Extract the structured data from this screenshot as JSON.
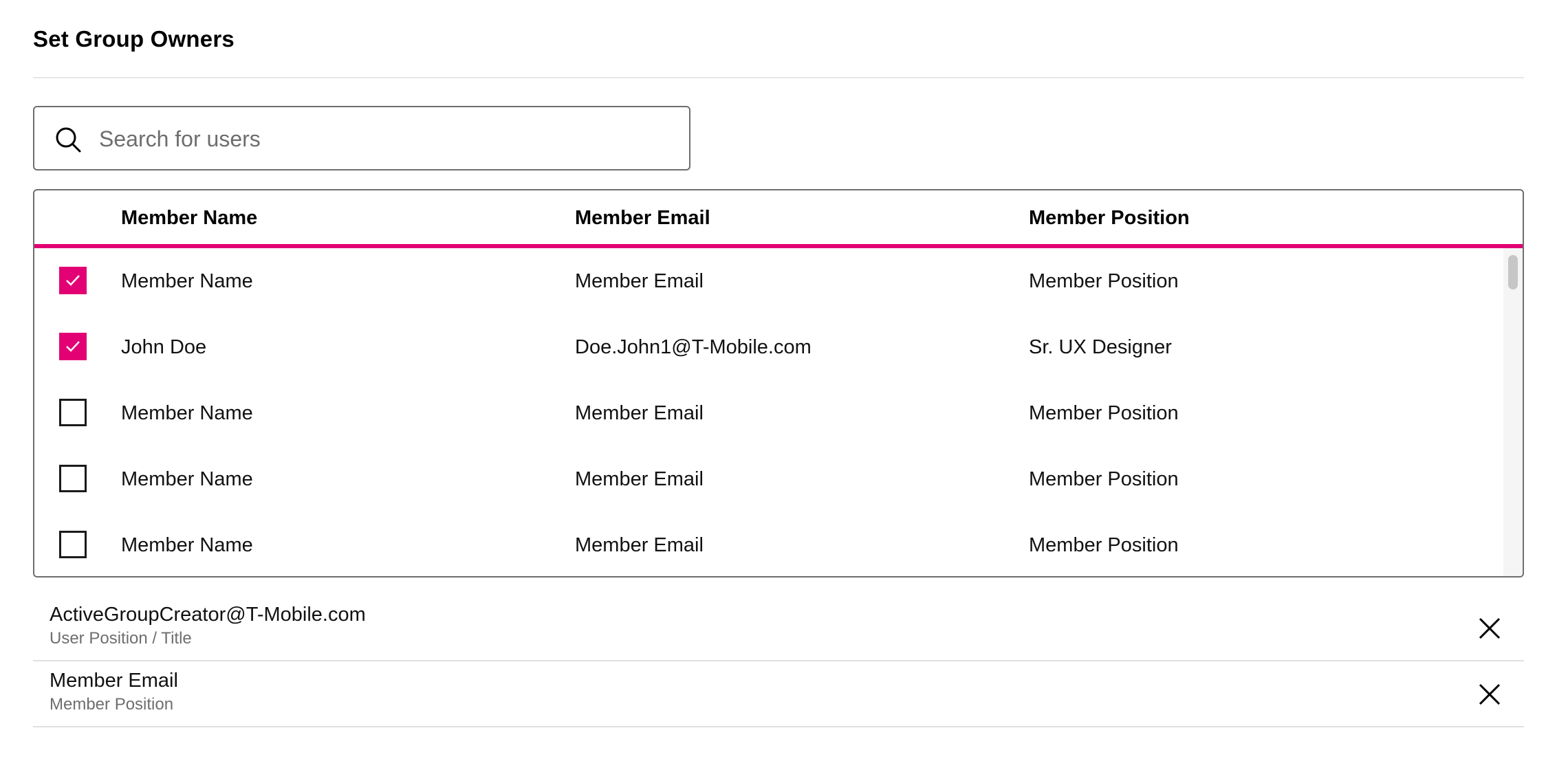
{
  "page": {
    "title": "Set Group Owners"
  },
  "search": {
    "placeholder": "Search for users",
    "value": "",
    "icon": "search-icon"
  },
  "table": {
    "columns": [
      "Member Name",
      "Member Email",
      "Member Position"
    ],
    "rows": [
      {
        "checked": true,
        "name": "Member Name",
        "email": "Member Email",
        "position": "Member Position"
      },
      {
        "checked": true,
        "name": "John Doe",
        "email": "Doe.John1@T-Mobile.com",
        "position": "Sr. UX Designer"
      },
      {
        "checked": false,
        "name": "Member Name",
        "email": "Member Email",
        "position": "Member Position"
      },
      {
        "checked": false,
        "name": "Member Name",
        "email": "Member Email",
        "position": "Member Position"
      },
      {
        "checked": false,
        "name": "Member Name",
        "email": "Member Email",
        "position": "Member Position"
      }
    ]
  },
  "owners": [
    {
      "primary": "ActiveGroupCreator@T-Mobile.com",
      "secondary": "User Position / Title",
      "remove_icon": "close-icon"
    },
    {
      "primary": "Member Email",
      "secondary": "Member Position",
      "remove_icon": "close-icon"
    }
  ],
  "colors": {
    "accent": "#e20074",
    "border": "#6e6e6e",
    "divider": "#e6e6e6",
    "muted_text": "#6e6e6e"
  }
}
